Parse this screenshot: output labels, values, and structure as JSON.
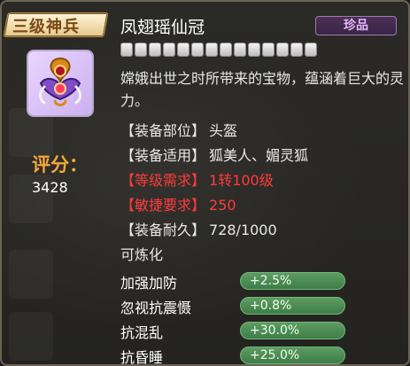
{
  "header": {
    "tier": "三级神兵",
    "item_name": "凤翅瑶仙冠",
    "rarity": "珍品"
  },
  "score": {
    "label": "评分：",
    "value": "3428"
  },
  "description": "嫦娥出世之时所带来的宝物，蕴涵着巨大的灵力。",
  "properties": [
    {
      "label": "【装备部位】",
      "value": "头盔",
      "color": "#e8e8e8"
    },
    {
      "label": "【装备适用】",
      "value": "狐美人、媚灵狐",
      "color": "#e8e8e8"
    },
    {
      "label": "【等级需求】",
      "value": "1转100级",
      "color": "#ff3b3b"
    },
    {
      "label": "【敏捷要求】",
      "value": "250",
      "color": "#ff3b3b"
    },
    {
      "label": "【装备耐久】",
      "value": "728/1000",
      "color": "#e8e8e8"
    }
  ],
  "refinable": "可炼化",
  "attributes": [
    {
      "name": "加强加防",
      "value": "+2.5%"
    },
    {
      "name": "忽视抗震慑",
      "value": "+0.8%"
    },
    {
      "name": "抗混乱",
      "value": "+30.0%"
    },
    {
      "name": "抗昏睡",
      "value": "+25.0%"
    }
  ],
  "colors": {
    "accent_gold": "#f5a83a",
    "attribute_green": "#4d8b55",
    "rarity_purple": "#e7b8ff"
  }
}
